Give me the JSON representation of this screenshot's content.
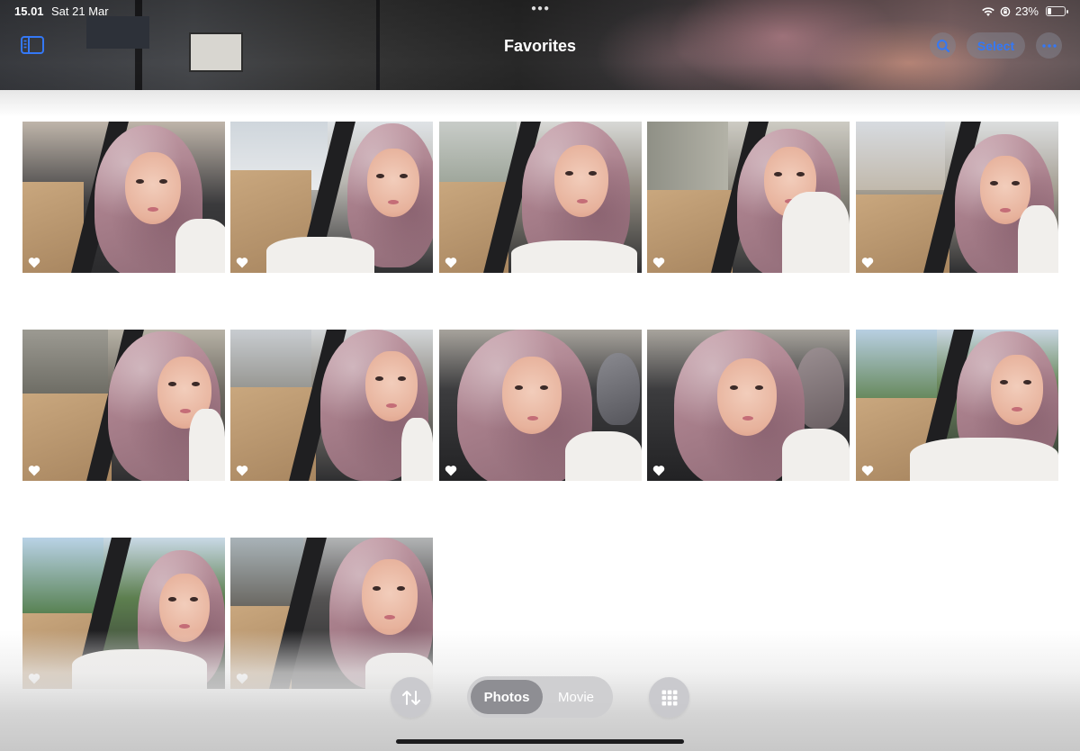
{
  "status_bar": {
    "time": "15.01",
    "date": "Sat 21 Mar",
    "battery_percent": "23%",
    "battery_level": 0.23
  },
  "header": {
    "title": "Favorites",
    "select_label": "Select",
    "icons": [
      "sidebar-icon",
      "search-icon",
      "more-icon"
    ]
  },
  "grid": {
    "photo_count": 12,
    "favorite_icon": "heart-icon",
    "rows": [
      [
        "photo-1",
        "photo-2",
        "photo-3",
        "photo-4",
        "photo-5"
      ],
      [
        "photo-6",
        "photo-7",
        "photo-8",
        "photo-9",
        "photo-10"
      ],
      [
        "photo-11",
        "photo-12"
      ]
    ]
  },
  "toolbar": {
    "sort_icon": "sort-arrows-icon",
    "segments": [
      "Photos",
      "Movie"
    ],
    "selected_segment": "Photos",
    "grid_icon": "grid-icon"
  },
  "colors": {
    "accent": "#3478f6",
    "toolbar_bg": "#cdcdd0",
    "segment_active": "#8e8e93"
  }
}
